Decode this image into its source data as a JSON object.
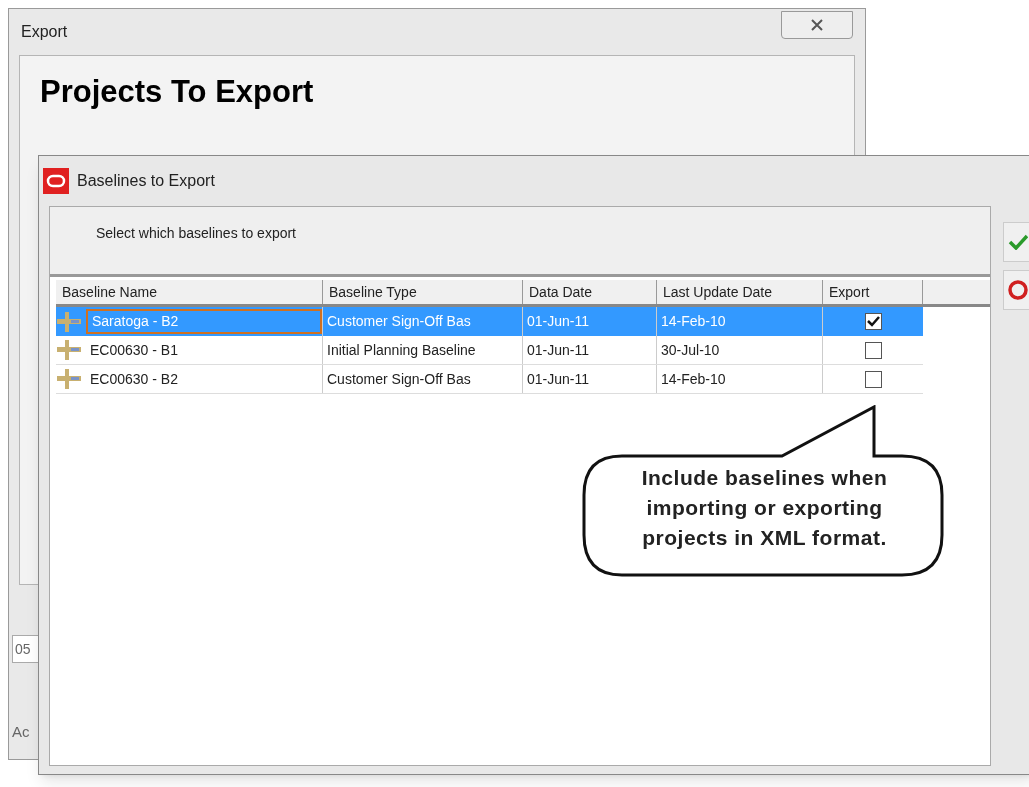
{
  "export_window": {
    "title": "Export",
    "heading": "Projects To Export",
    "field_value": "05",
    "label": "Ac"
  },
  "baselines_dialog": {
    "title": "Baselines to Export",
    "instruction": "Select which baselines to export",
    "table": {
      "columns": [
        "Baseline Name",
        "Baseline Type",
        "Data Date",
        "Last Update Date",
        "Export"
      ],
      "rows": [
        {
          "name": "Saratoga - B2",
          "type": "Customer Sign-Off Bas",
          "data_date": "01-Jun-11",
          "last_update": "14-Feb-10",
          "export": true,
          "selected": true
        },
        {
          "name": "EC00630 - B1",
          "type": "Initial Planning Baseline",
          "data_date": "01-Jun-11",
          "last_update": "30-Jul-10",
          "export": false,
          "selected": false
        },
        {
          "name": "EC00630 - B2",
          "type": "Customer Sign-Off Bas",
          "data_date": "01-Jun-11",
          "last_update": "14-Feb-10",
          "export": false,
          "selected": false
        }
      ]
    }
  },
  "callout": {
    "text": "Include baselines when importing or exporting projects in XML format."
  }
}
